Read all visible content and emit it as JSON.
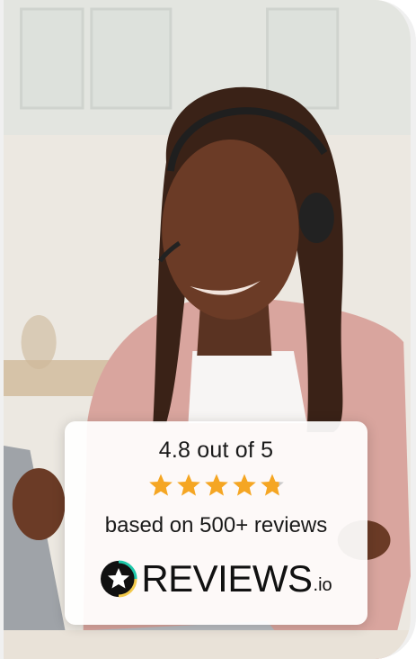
{
  "review_widget": {
    "rating_text": "4.8 out of 5",
    "rating_value": 4.8,
    "rating_max": 5,
    "based_on_text": "based on 500+ reviews",
    "brand_name": "REVIEWS",
    "brand_suffix": ".io",
    "star_color": "#f5a623",
    "star_empty_color": "#c9c9c9"
  },
  "photo": {
    "icon": "woman-with-headset-photo"
  }
}
